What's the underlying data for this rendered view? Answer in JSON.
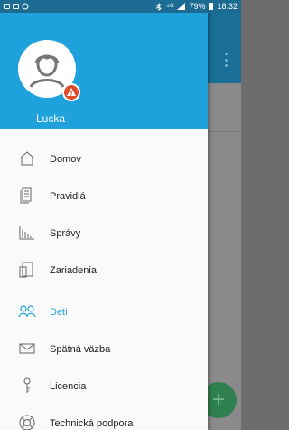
{
  "status_bar": {
    "signal_text": "⁴ᴳ",
    "battery_percent": "79%",
    "time": "18:32"
  },
  "drawer": {
    "user_name": "Lucka",
    "items": [
      {
        "label": "Domov",
        "icon": "home-icon"
      },
      {
        "label": "Pravidlá",
        "icon": "rules-icon"
      },
      {
        "label": "Správy",
        "icon": "reports-icon"
      },
      {
        "label": "Zariadenia",
        "icon": "devices-icon"
      },
      {
        "label": "Deti",
        "icon": "children-icon",
        "active": true
      },
      {
        "label": "Spätná väzba",
        "icon": "feedback-icon"
      },
      {
        "label": "Licencia",
        "icon": "license-icon"
      },
      {
        "label": "Technická podpora",
        "icon": "support-icon"
      }
    ]
  },
  "colors": {
    "accent": "#1fa2dc",
    "status_bar": "#1c6b93",
    "warning": "#e04a2a",
    "fab": "#2f7f4f"
  },
  "fab": {
    "icon": "add-icon",
    "symbol": "+"
  }
}
